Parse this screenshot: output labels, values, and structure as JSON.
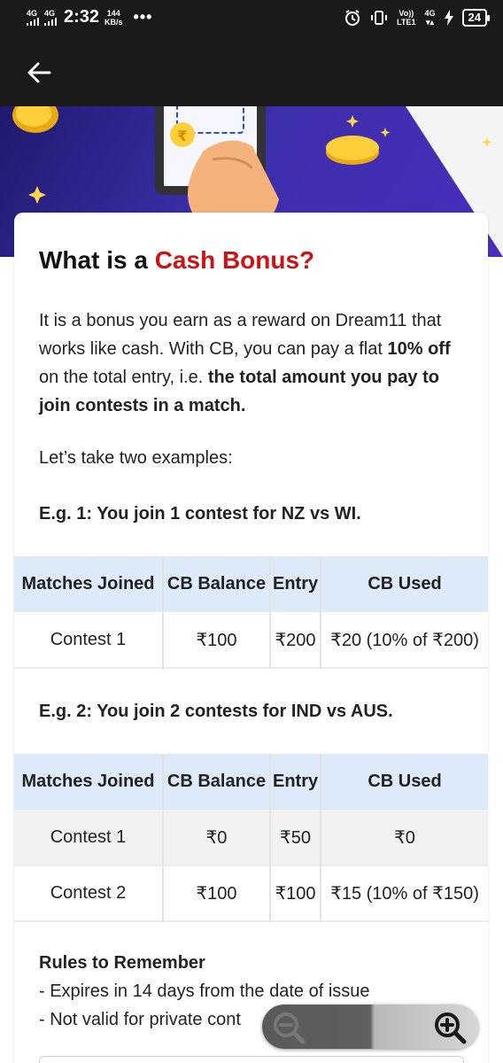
{
  "status_bar": {
    "sim1": "4G",
    "sim2": "4G",
    "time": "2:32",
    "speed_value": "144",
    "speed_unit": "KB/s",
    "more": "•••",
    "volte": "Vo))",
    "lte": "LTE1",
    "net": "4G",
    "battery": "24"
  },
  "header": {
    "back_icon": "arrow-left-icon"
  },
  "article": {
    "title_prefix": "What is a ",
    "title_highlight": "Cash Bonus?",
    "intro_1": "It is a bonus you earn as a reward on Dream11 that works like cash. With CB, you can pay a flat ",
    "intro_bold_1": "10% off",
    "intro_2": " on the total entry, i.e. ",
    "intro_bold_2": "the total amount you pay to join contests in a match.",
    "examples_intro": "Let’s take two examples:",
    "example1_title": "E.g. 1: You join 1 contest for NZ vs WI.",
    "example2_title": "E.g. 2: You join 2 contests for IND vs AUS.",
    "table_headers": [
      "Matches Joined",
      "CB Balance",
      "Entry",
      "CB Used"
    ],
    "example1_rows": [
      [
        "Contest 1",
        "₹100",
        "₹200",
        "₹20 (10% of ₹200)"
      ]
    ],
    "example2_rows": [
      [
        "Contest 1",
        "₹0",
        "₹50",
        "₹0"
      ],
      [
        "Contest 2",
        "₹100",
        "₹100",
        "₹15 (10% of ₹150)"
      ]
    ],
    "rules_title": "Rules to Remember",
    "rules": [
      "- Expires in 14 days from the date of issue",
      "- Not valid for private cont"
    ]
  },
  "zoom": {
    "zoom_out_icon": "zoom-out-icon",
    "zoom_in_icon": "zoom-in-icon"
  },
  "colors": {
    "highlight": "#d11111",
    "table_header_bg": "#ddeaf9",
    "app_bar": "#1a1a1a"
  }
}
